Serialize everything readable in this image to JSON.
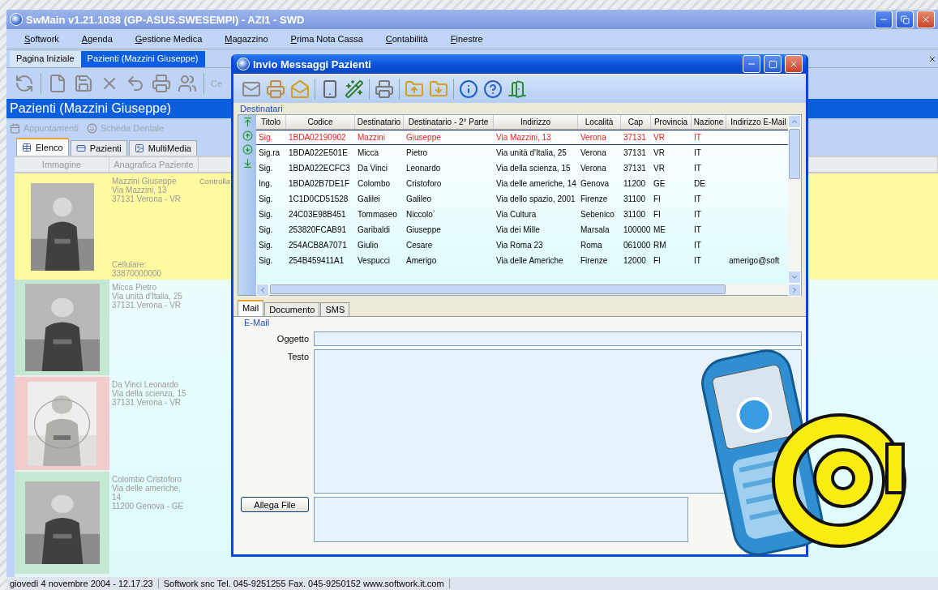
{
  "main_window": {
    "title": "SwMain v1.21.1038 (GP-ASUS.SWESEMPI) - AZI1 - SWD",
    "menu": [
      "Softwork",
      "Agenda",
      "Gestione Medica",
      "Magazzino",
      "Prima Nota Cassa",
      "Contabilità",
      "Finestre"
    ],
    "doc_tabs": [
      {
        "label": "Pagina Iniziale",
        "selected": false
      },
      {
        "label": "Pazienti (Mazzini Giuseppe)",
        "selected": true
      }
    ],
    "toolbar_label": "Ce",
    "heading": "Pazienti (Mazzini Giuseppe)",
    "actions": [
      {
        "label": "Appuntamenti",
        "disabled": true
      },
      {
        "label": "Scheda Dentale",
        "disabled": true
      }
    ],
    "view_tabs": [
      {
        "label": "Elenco",
        "selected": true
      },
      {
        "label": "Pazienti",
        "selected": false
      },
      {
        "label": "MultiMedia",
        "selected": false
      }
    ],
    "grid": {
      "columns": [
        "Immagine",
        "Anagrafica Paziente"
      ],
      "rows": [
        {
          "lines": [
            "Mazzini Giuseppe",
            "Via Mazzini, 13",
            "37131 Verona - VR"
          ],
          "phone_label": "Cellulare:",
          "phone": "33870000000",
          "column_3": "Controlla",
          "selected": true,
          "color": "#fffaa0"
        },
        {
          "lines": [
            "Micca Pietro",
            "Via unità d'Italia, 25",
            "37131 Verona - VR"
          ],
          "selected": false,
          "color": "#c4e8d2"
        },
        {
          "lines": [
            "Da Vinci Leonardo",
            "Via della scienza, 15",
            "37131 Verona - VR"
          ],
          "selected": false,
          "color": "#f2cccc"
        },
        {
          "lines": [
            "Colombo Cristoforo",
            "Via delle americhe,",
            "14",
            "11200 Genova - GE"
          ],
          "selected": false,
          "color": "#c4e8d2"
        }
      ]
    },
    "status_bar": [
      "giovedì 4 novembre 2004 - 12.17.23",
      "Softwork snc Tel. 045-9251255 Fax. 045-9250152 www.softwork.it.com"
    ]
  },
  "dialog": {
    "title": "Invio Messaggi Pazienti",
    "group": "Destinatari",
    "columns": [
      "Titolo",
      "Codice",
      "Destinatario",
      "Destinatario - 2° Parte",
      "Indirizzo",
      "Località",
      "Cap",
      "Provincia",
      "Nazione",
      "Indirizzo E-Mail"
    ],
    "rows": [
      {
        "cells": [
          "Sig.",
          "1BDA02190902",
          "Mazzini",
          "Giuseppe",
          "Via Mazzini, 13",
          "Verona",
          "37131",
          "VR",
          "IT"
        ],
        "selected": true
      },
      {
        "cells": [
          "Sig.ra",
          "1BDA022E501E",
          "Micca",
          "Pietro",
          "Via unità d'Italia, 25",
          "Verona",
          "37131",
          "VR",
          "IT"
        ],
        "selected": false
      },
      {
        "cells": [
          "Sig.",
          "1BDA022ECFC3",
          "Da Vinci",
          "Leonardo",
          "Via della scienza, 15",
          "Verona",
          "37131",
          "VR",
          "IT"
        ],
        "selected": false
      },
      {
        "cells": [
          "Ing.",
          "1BDA02B7DE1F",
          "Colombo",
          "Cristoforo",
          "Via delle americhe, 14",
          "Genova",
          "11200",
          "GE",
          "DE"
        ],
        "selected": false
      },
      {
        "cells": [
          "Sig.",
          "1C1D0CD51528",
          "Galilei",
          "Galileo",
          "Via dello spazio, 2001",
          "Firenze",
          "31100",
          "FI",
          "IT"
        ],
        "selected": false
      },
      {
        "cells": [
          "Sig.",
          "24C03E98B451",
          "Tommaseo",
          "Niccolo`",
          "Via Cultura",
          "Sebenico",
          "31100",
          "FI",
          "IT"
        ],
        "selected": false
      },
      {
        "cells": [
          "Sig.",
          "253820FCAB91",
          "Garibaldi",
          "Giuseppe",
          "Via dei Mille",
          "Marsala",
          "100000",
          "ME",
          "IT"
        ],
        "selected": false
      },
      {
        "cells": [
          "Sig.",
          "254ACB8A7071",
          "Giulio",
          "Cesare",
          "Via Roma 23",
          "Roma",
          "061000",
          "RM",
          "IT"
        ],
        "selected": false
      },
      {
        "cells": [
          "Sig.",
          "254B459411A1",
          "Vespucci",
          "Amerigo",
          "Via delle Americhe",
          "Firenze",
          "12000",
          "FI",
          "IT",
          "amerigo@soft"
        ],
        "selected": false
      }
    ],
    "tabs": [
      {
        "label": "Mail",
        "selected": true
      },
      {
        "label": "Documento",
        "selected": false
      },
      {
        "label": "SMS",
        "selected": false
      }
    ],
    "mail": {
      "group": "E-Mail",
      "subject_label": "Oggetto",
      "body_label": "Testo",
      "attach_button": "Allega File"
    }
  }
}
